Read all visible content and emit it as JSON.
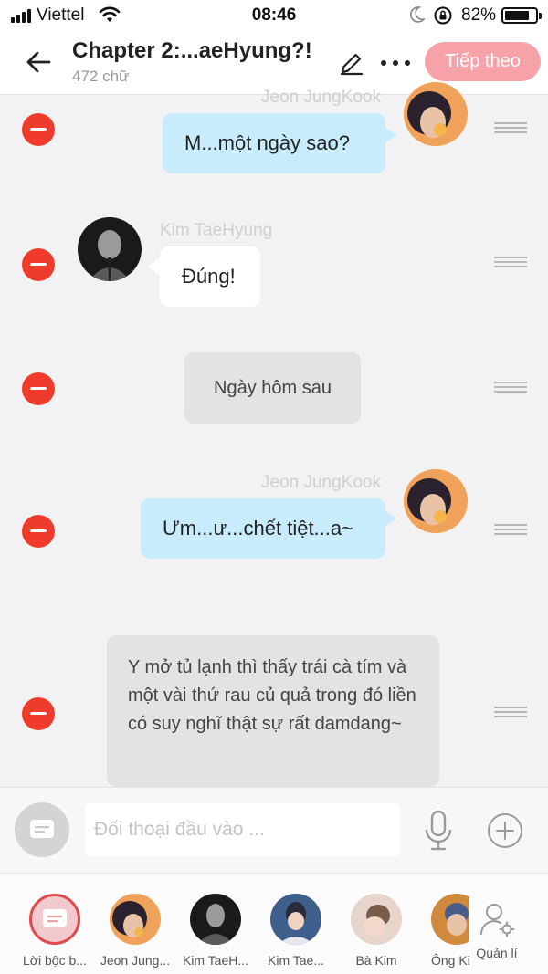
{
  "status_bar": {
    "carrier": "Viettel",
    "time": "08:46",
    "battery_percent": "82%",
    "battery_level": 0.82,
    "icons": [
      "signal-icon",
      "wifi-icon",
      "moon-icon",
      "rotation-lock-icon",
      "battery-icon"
    ]
  },
  "header": {
    "title": "Chapter 2:...aeHyung?!",
    "word_count": "472 chữ",
    "next_label": "Tiếp theo",
    "next_color": "#f6a2a8",
    "icons": [
      "back-arrow-icon",
      "pencil-icon",
      "more-dots-icon"
    ]
  },
  "messages": [
    {
      "type": "right",
      "sender": "Jeon JungKook",
      "text": "M...một ngày sao?",
      "bubble_color": "#c8ecfb"
    },
    {
      "type": "left",
      "sender": "Kim TaeHyung",
      "text": "Đúng!",
      "bubble_color": "#ffffff"
    },
    {
      "type": "narration",
      "text": "Ngày hôm sau",
      "bubble_color": "#e3e3e3"
    },
    {
      "type": "right",
      "sender": "Jeon JungKook",
      "text": "Ưm...ư...chết tiệt...a~",
      "bubble_color": "#c8ecfb"
    },
    {
      "type": "narration",
      "text": "Y mở tủ lạnh thì thấy trái cà tím và một vài thứ rau củ quả trong đó liền có suy nghĩ thật sự rất damdang~",
      "bubble_color": "#e3e3e3"
    }
  ],
  "input": {
    "placeholder": "Đối thoại đầu vào ..."
  },
  "characters": [
    {
      "label": "Lời bộc b..."
    },
    {
      "label": "Jeon Jung..."
    },
    {
      "label": "Kim TaeH..."
    },
    {
      "label": "Kim Tae..."
    },
    {
      "label": "Bà Kim"
    },
    {
      "label": "Ông Kir"
    }
  ],
  "manage_label": "Quản lí",
  "accent_colors": {
    "delete": "#ef3b2c",
    "selected_ring": "#e14a4a"
  }
}
